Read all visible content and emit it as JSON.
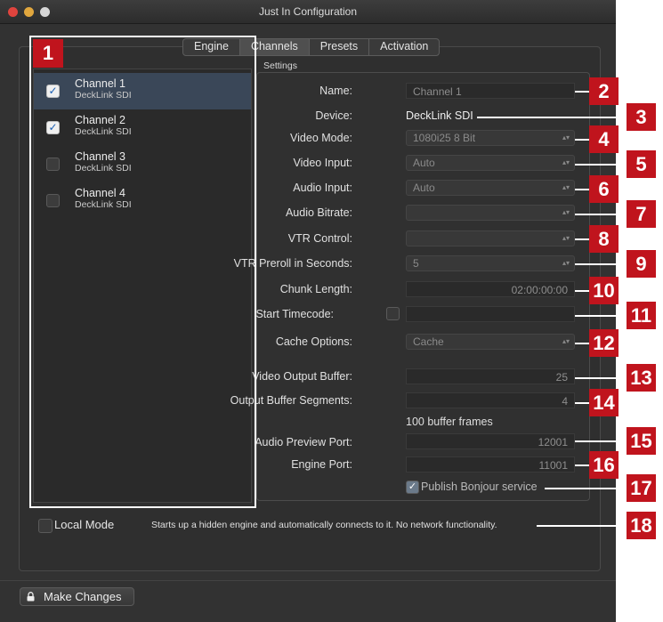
{
  "window": {
    "title": "Just In Configuration"
  },
  "tabs": [
    {
      "label": "Engine"
    },
    {
      "label": "Channels"
    },
    {
      "label": "Presets"
    },
    {
      "label": "Activation"
    }
  ],
  "channels": [
    {
      "name": "Channel 1",
      "device": "DeckLink SDI",
      "checked": true,
      "selected": true
    },
    {
      "name": "Channel 2",
      "device": "DeckLink SDI",
      "checked": true,
      "selected": false
    },
    {
      "name": "Channel 3",
      "device": "DeckLink SDI",
      "checked": false,
      "selected": false
    },
    {
      "name": "Channel 4",
      "device": "DeckLink SDI",
      "checked": false,
      "selected": false
    }
  ],
  "settings": {
    "section_label": "Settings",
    "name_label": "Name:",
    "name_value": "Channel 1",
    "device_label": "Device:",
    "device_value": "DeckLink SDI",
    "video_mode_label": "Video Mode:",
    "video_mode_value": "1080i25 8 Bit",
    "video_input_label": "Video Input:",
    "video_input_value": "Auto",
    "audio_input_label": "Audio Input:",
    "audio_input_value": "Auto",
    "audio_bitrate_label": "Audio Bitrate:",
    "audio_bitrate_value": "",
    "vtr_control_label": "VTR Control:",
    "vtr_control_value": "",
    "vtr_preroll_label": "VTR Preroll in Seconds:",
    "vtr_preroll_value": "5",
    "chunk_length_label": "Chunk Length:",
    "chunk_length_value": "02:00:00:00",
    "start_timecode_label": "Start Timecode:",
    "start_timecode_value": "",
    "cache_options_label": "Cache Options:",
    "cache_options_value": "Cache",
    "video_output_buffer_label": "Video Output Buffer:",
    "video_output_buffer_value": "25",
    "output_buffer_segments_label": "Output Buffer Segments:",
    "output_buffer_segments_value": "4",
    "buffer_frames_note": "100 buffer frames",
    "audio_preview_port_label": "Audio Preview Port:",
    "audio_preview_port_value": "12001",
    "engine_port_label": "Engine Port:",
    "engine_port_value": "11001",
    "publish_bonjour_label": "Publish Bonjour service",
    "publish_bonjour_checked": true
  },
  "local_mode": {
    "label": "Local Mode",
    "description": "Starts up a hidden engine and automatically connects to it. No network functionality.",
    "checked": false
  },
  "footer": {
    "make_changes_label": "Make Changes"
  },
  "callouts": [
    "1",
    "2",
    "3",
    "4",
    "5",
    "6",
    "7",
    "8",
    "9",
    "10",
    "11",
    "12",
    "13",
    "14",
    "15",
    "16",
    "17",
    "18"
  ],
  "colors": {
    "callout_red": "#c0141d",
    "window_bg": "#323232",
    "selection": "#3a4758"
  }
}
